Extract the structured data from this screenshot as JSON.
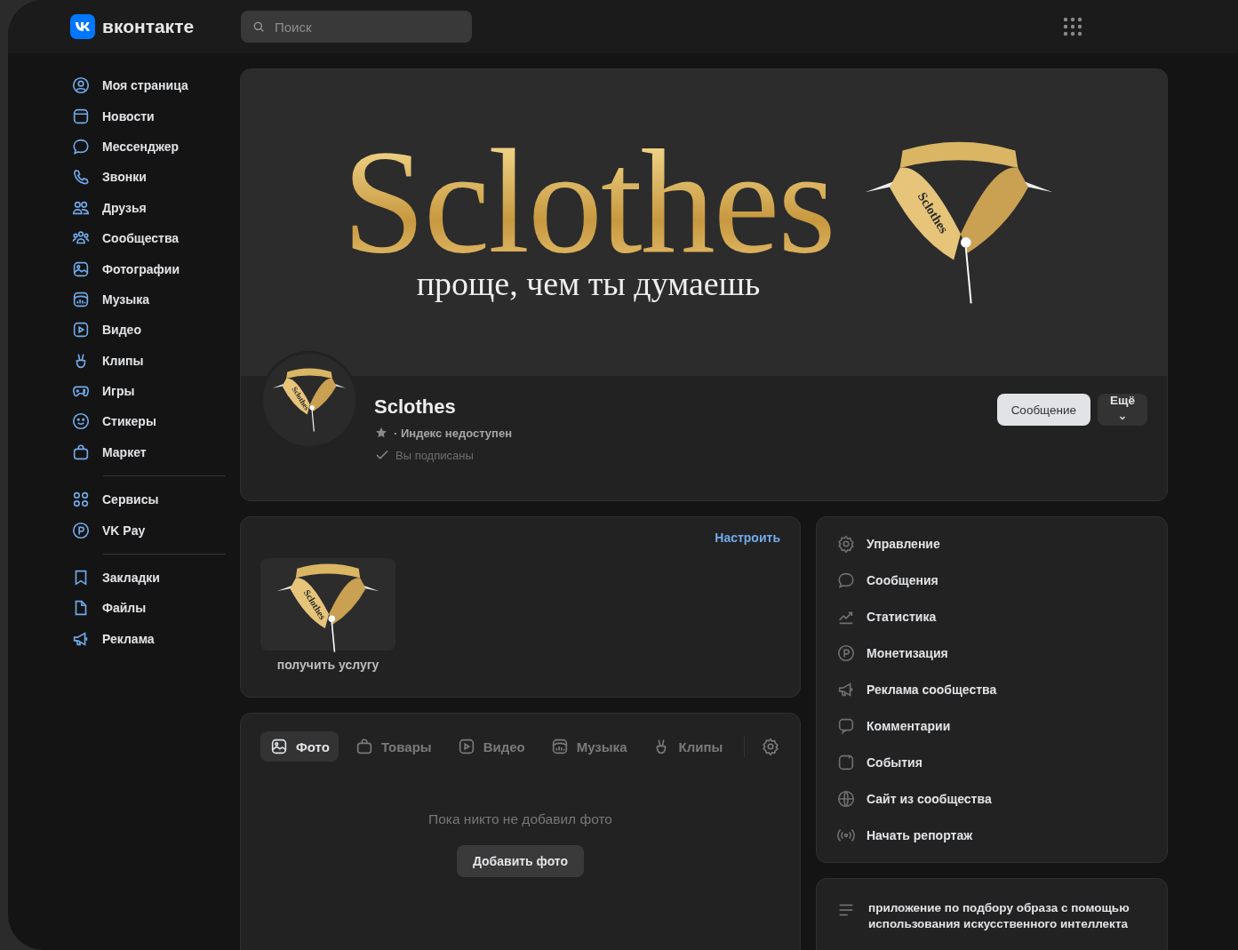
{
  "header": {
    "brand": "вконтакте",
    "search": {
      "placeholder": "Поиск"
    }
  },
  "sidebar": {
    "groups": [
      {
        "items": [
          {
            "label": "Моя страница"
          },
          {
            "label": "Новости"
          },
          {
            "label": "Мессенджер"
          },
          {
            "label": "Звонки"
          },
          {
            "label": "Друзья"
          },
          {
            "label": "Сообщества"
          },
          {
            "label": "Фотографии"
          },
          {
            "label": "Музыка"
          },
          {
            "label": "Видео"
          },
          {
            "label": "Клипы"
          },
          {
            "label": "Игры"
          },
          {
            "label": "Стикеры"
          },
          {
            "label": "Маркет"
          }
        ]
      },
      {
        "items": [
          {
            "label": "Сервисы"
          },
          {
            "label": "VK Pay"
          }
        ]
      },
      {
        "items": [
          {
            "label": "Закладки"
          },
          {
            "label": "Файлы"
          },
          {
            "label": "Реклама"
          }
        ]
      }
    ]
  },
  "cover": {
    "title": "Sclothes",
    "tagline": "проще, чем ты думаешь",
    "logo_label": "Sclothes"
  },
  "profile": {
    "avatar_label": "Sclothes",
    "name": "Sclothes",
    "rating": "· Индекс недоступен",
    "subscription": "Вы подписаны",
    "buttons": [
      {
        "label": "Сообщение",
        "kind": "primary"
      },
      {
        "label": "Ещё",
        "kind": "menu"
      }
    ]
  },
  "services": {
    "action": "Настроить",
    "items": [
      {
        "label": "получить услугу",
        "logo_label": "Sclothes"
      }
    ]
  },
  "media": {
    "tabs": [
      {
        "label": "Фото",
        "selected": true
      },
      {
        "label": "Товары",
        "selected": false
      },
      {
        "label": "Видео",
        "selected": false
      },
      {
        "label": "Музыка",
        "selected": false
      },
      {
        "label": "Клипы",
        "selected": false
      }
    ],
    "empty_text": "Пока никто не добавил фото",
    "add_button": "Добавить фото"
  },
  "manage_menu": {
    "items": [
      {
        "label": "Управление"
      },
      {
        "label": "Сообщения"
      },
      {
        "label": "Статистика"
      },
      {
        "label": "Монетизация"
      },
      {
        "label": "Реклама сообщества"
      },
      {
        "label": "Комментарии"
      },
      {
        "label": "События"
      },
      {
        "label": "Сайт из сообщества"
      },
      {
        "label": "Начать репортаж"
      }
    ]
  },
  "info": {
    "description": "приложение по подбору образа с помощью использования искусственного интеллекта"
  }
}
